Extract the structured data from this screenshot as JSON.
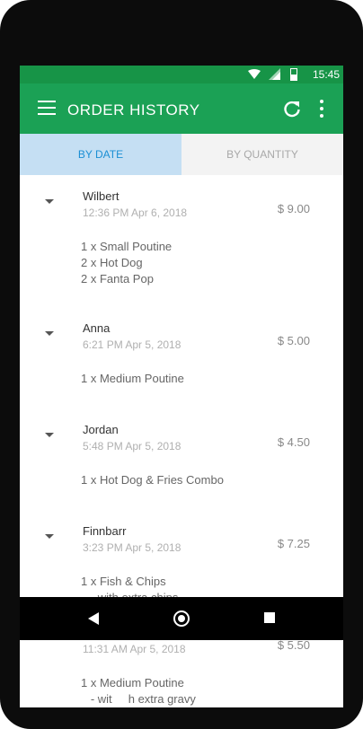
{
  "status_bar": {
    "time": "15:45",
    "wifi_icon": "wifi-icon",
    "signal_icon": "signal-icon",
    "battery_icon": "battery-icon"
  },
  "app_bar": {
    "title": "ORDER HISTORY",
    "menu_icon": "menu-icon",
    "refresh_icon": "refresh-icon",
    "more_icon": "more-vert-icon"
  },
  "tabs": [
    {
      "label": "BY DATE",
      "active": true
    },
    {
      "label": "BY QUANTITY",
      "active": false
    }
  ],
  "orders": [
    {
      "name": "Wilbert",
      "date": "12:36 PM  Apr 6, 2018",
      "total": "$ 9.00",
      "items": [
        "1 x Small Poutine",
        "2 x Hot Dog",
        "2 x Fanta Pop"
      ]
    },
    {
      "name": "Anna",
      "date": "6:21 PM  Apr 5, 2018",
      "total": "$ 5.00",
      "items": [
        "1 x Medium Poutine"
      ]
    },
    {
      "name": "Jordan",
      "date": "5:48 PM Apr 5, 2018",
      "total": "$ 4.50",
      "items": [
        "1 x Hot Dog & Fries Combo"
      ]
    },
    {
      "name": "Finnbarr",
      "date": "3:23 PM Apr 5, 2018",
      "total": "$ 7.25",
      "items": [
        "1 x Fish & Chips",
        "   - with extra chips"
      ]
    },
    {
      "name": "",
      "date": "11:31 AM Apr 5, 2018",
      "total": "$ 5.50",
      "items": [
        "1 x Medium Poutine",
        "   - wit     h extra gravy"
      ]
    }
  ],
  "nav_bar": {
    "back_icon": "back-icon",
    "home_icon": "home-icon",
    "recents_icon": "recents-icon"
  },
  "colors": {
    "status_bar": "#179447",
    "app_bar": "#1ba155",
    "tab_active_bg": "#c5dff3",
    "tab_active_text": "#1b8fd4",
    "tab_inactive_bg": "#f3f3f3"
  }
}
